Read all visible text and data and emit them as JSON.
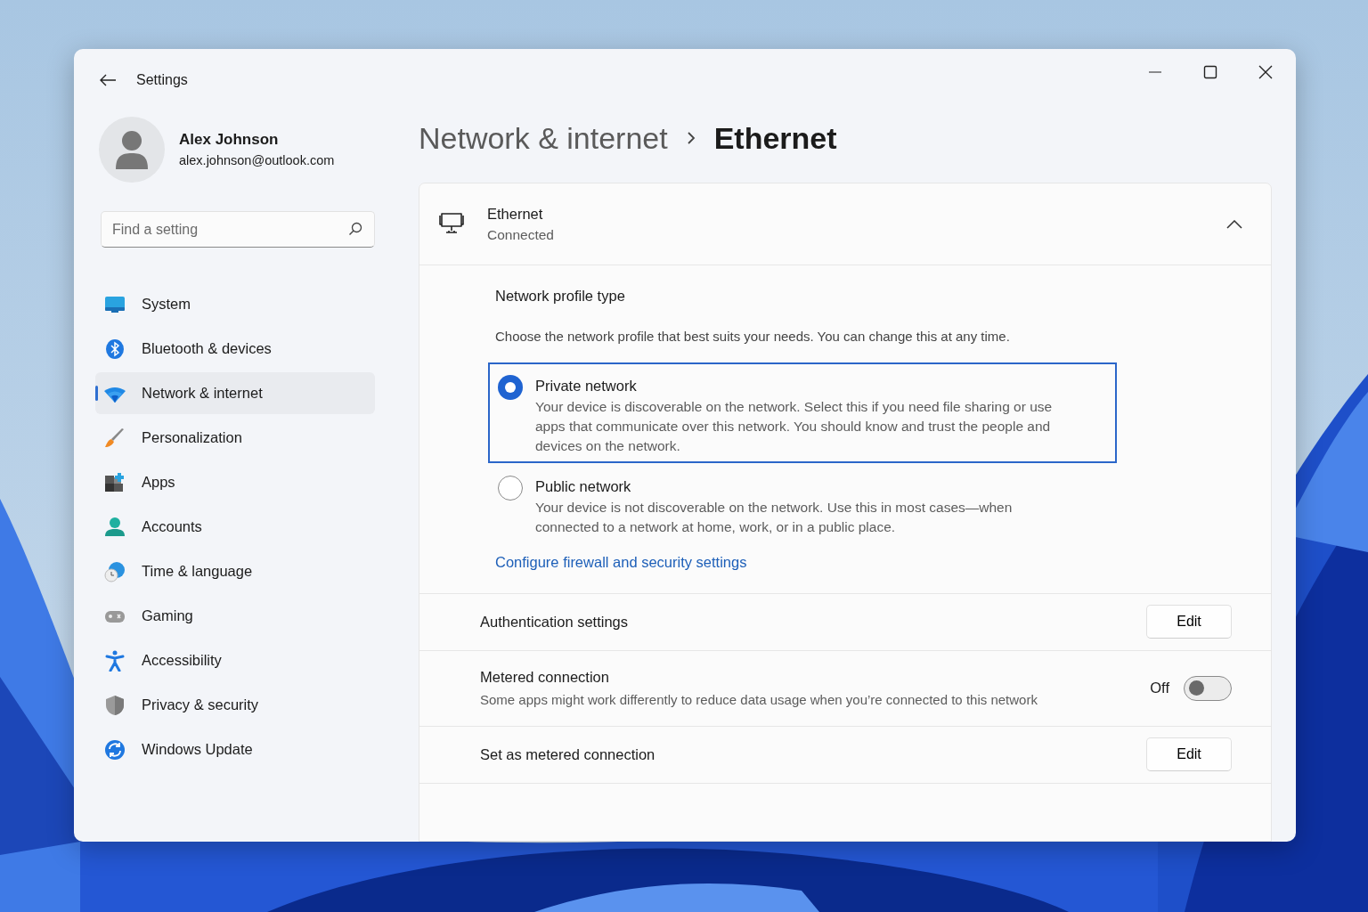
{
  "window": {
    "title": "Settings"
  },
  "user": {
    "name": "Alex Johnson",
    "email": "alex.johnson@outlook.com"
  },
  "search": {
    "placeholder": "Find a setting"
  },
  "nav": [
    {
      "label": "System",
      "selected": false
    },
    {
      "label": "Bluetooth & devices",
      "selected": false
    },
    {
      "label": "Network & internet",
      "selected": true
    },
    {
      "label": "Personalization",
      "selected": false
    },
    {
      "label": "Apps",
      "selected": false
    },
    {
      "label": "Accounts",
      "selected": false
    },
    {
      "label": "Time & language",
      "selected": false
    },
    {
      "label": "Gaming",
      "selected": false
    },
    {
      "label": "Accessibility",
      "selected": false
    },
    {
      "label": "Privacy & security",
      "selected": false
    },
    {
      "label": "Windows Update",
      "selected": false
    }
  ],
  "breadcrumb": [
    "Network & internet",
    "Ethernet"
  ],
  "adapter": {
    "name": "Ethernet",
    "status": "Connected",
    "expanded": true
  },
  "profile": {
    "title": "Network profile type",
    "description": "Choose the network profile that best suits your needs. You can change this at any time.",
    "options": [
      {
        "label": "Private network",
        "description": "Your device is discoverable on the network. Select this if you need file sharing or use apps that communicate over this network. You should know and trust the people and devices on the network.",
        "selected": true
      },
      {
        "label": "Public network",
        "description": "Your device is not discoverable on the network. Use this in most cases—when connected to a network at home, work, or in a public place.",
        "selected": false
      }
    ],
    "link": "Configure firewall and security settings"
  },
  "settings": [
    {
      "kind": "button",
      "label": "Authentication settings",
      "button": "Edit"
    },
    {
      "kind": "toggle",
      "label": "Metered connection",
      "description": "Some apps might work differently to reduce data usage when you’re connected to this network",
      "state_label": "Off",
      "on": false
    },
    {
      "kind": "button",
      "label": "Set as metered connection",
      "button": "Edit"
    }
  ]
}
